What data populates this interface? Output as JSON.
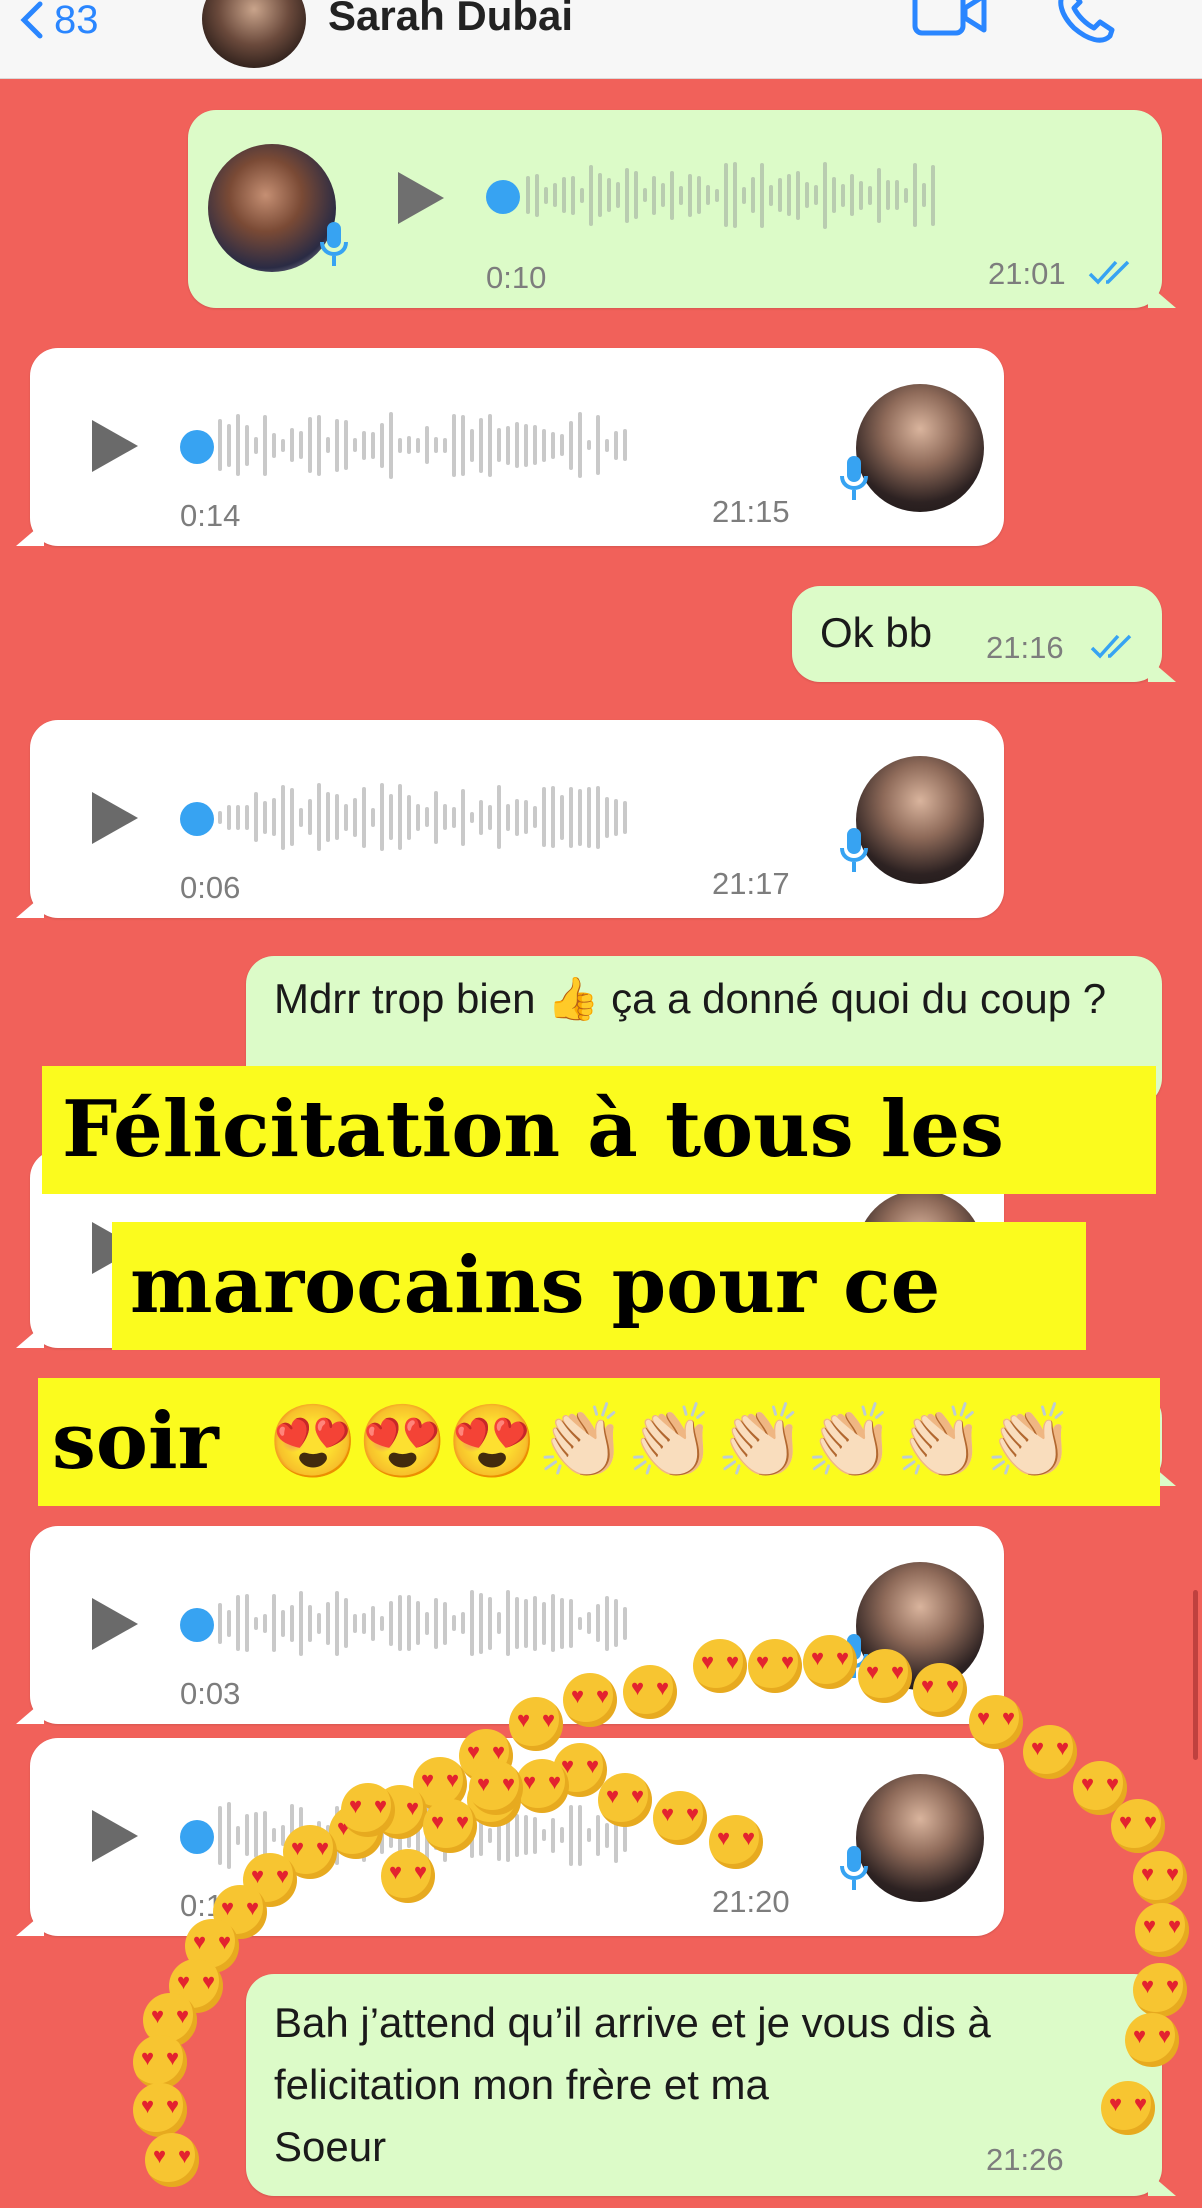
{
  "header": {
    "back_count": "83",
    "contact_name": "Sarah Dubai",
    "icons": [
      "chevron-left-icon",
      "video-call-icon",
      "phone-icon"
    ]
  },
  "messages": {
    "m1": {
      "duration": "0:10",
      "time": "21:01",
      "status": "read"
    },
    "m2": {
      "duration": "0:14",
      "time": "21:15"
    },
    "m3": {
      "text": "Ok bb",
      "time": "21:16",
      "status": "read"
    },
    "m4": {
      "duration": "0:06",
      "time": "21:17"
    },
    "m5": {
      "text": "Mdrr trop bien 👍 ça a donné quoi du coup ?"
    },
    "m8": {
      "duration": "0:03"
    },
    "m9": {
      "duration": "0:1",
      "time": "21:20"
    },
    "m10": {
      "line1": "Bah j’attend qu’il arrive et je vous dis à",
      "line2": "felicitation mon frère et ma",
      "line3": "Soeur",
      "time": "21:26"
    }
  },
  "overlay": {
    "line1": "Félicitation à tous les",
    "line2": "marocains pour ce",
    "line3_text": "soir",
    "line3_emoji": "😍😍😍👏🏻👏🏻👏🏻👏🏻👏🏻👏🏻",
    "decoration": "heart-eyes-emoji-arc"
  },
  "colors": {
    "background": "#f1615a",
    "outgoing_bubble": "#dcfbc8",
    "incoming_bubble": "#ffffff",
    "accent_blue": "#37a3f2",
    "caption_highlight": "#fbfb1e"
  }
}
